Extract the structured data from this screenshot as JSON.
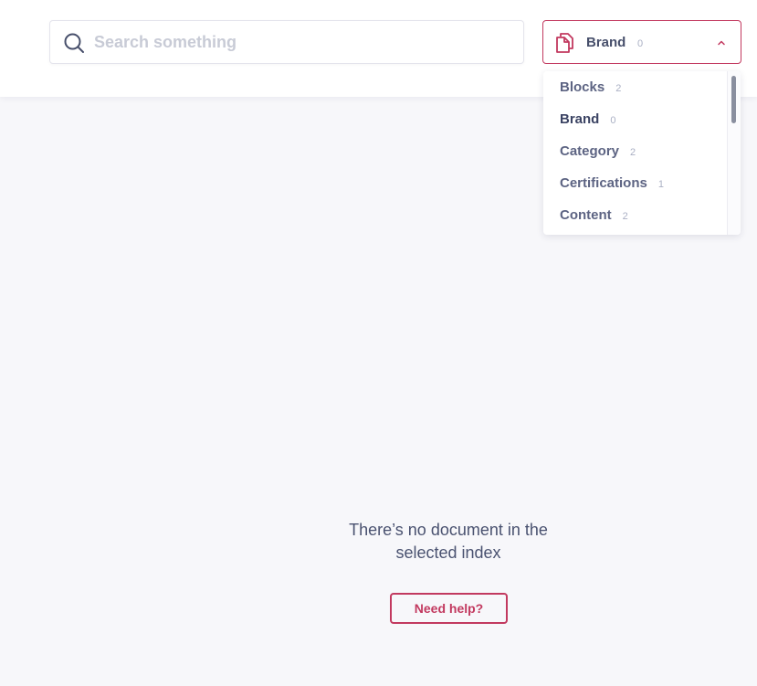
{
  "search": {
    "placeholder": "Search something",
    "value": ""
  },
  "index_selector": {
    "selected_label": "Brand",
    "selected_count": "0",
    "icon": "document-copy-icon",
    "expanded": true,
    "accent_color": "#c2395f"
  },
  "dropdown": {
    "items": [
      {
        "label": "Blocks",
        "count": "2"
      },
      {
        "label": "Brand",
        "count": "0"
      },
      {
        "label": "Category",
        "count": "2"
      },
      {
        "label": "Certifications",
        "count": "1"
      },
      {
        "label": "Content",
        "count": "2"
      }
    ]
  },
  "empty_state": {
    "message_line1": "There’s no document in the",
    "message_line2": "selected index",
    "help_label": "Need help?"
  }
}
